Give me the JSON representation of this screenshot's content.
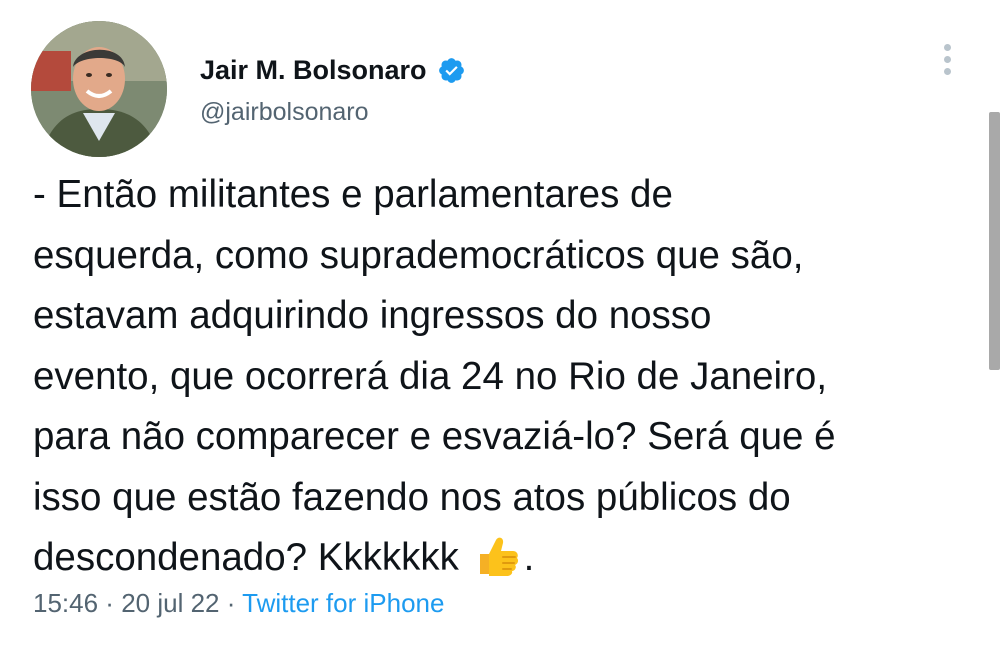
{
  "author": {
    "display_name": "Jair M. Bolsonaro",
    "handle": "@jairbolsonaro",
    "verified_icon": "verified-badge-icon",
    "avatar_icon": "avatar"
  },
  "menu": {
    "icon": "more-vertical-icon"
  },
  "tweet": {
    "text_main": "- Então militantes e parlamentares de\nesquerda, como suprademocráticos que são,\nestavam adquirindo ingressos do nosso\nevento, que ocorrerá dia 24 no Rio de Janeiro,\npara não comparecer e esvaziá-lo? Será que é\nisso que estão fazendo nos atos públicos do\ndescondenado? Kkkkkkk",
    "emoji": "thumbs-up-icon",
    "text_end": "."
  },
  "meta": {
    "time": "15:46",
    "separator1": " · ",
    "date": "20 jul 22",
    "separator2": " · ",
    "source": "Twitter for iPhone"
  },
  "colors": {
    "text": "#0f1419",
    "secondary": "#536471",
    "accent": "#1d9bf0"
  }
}
